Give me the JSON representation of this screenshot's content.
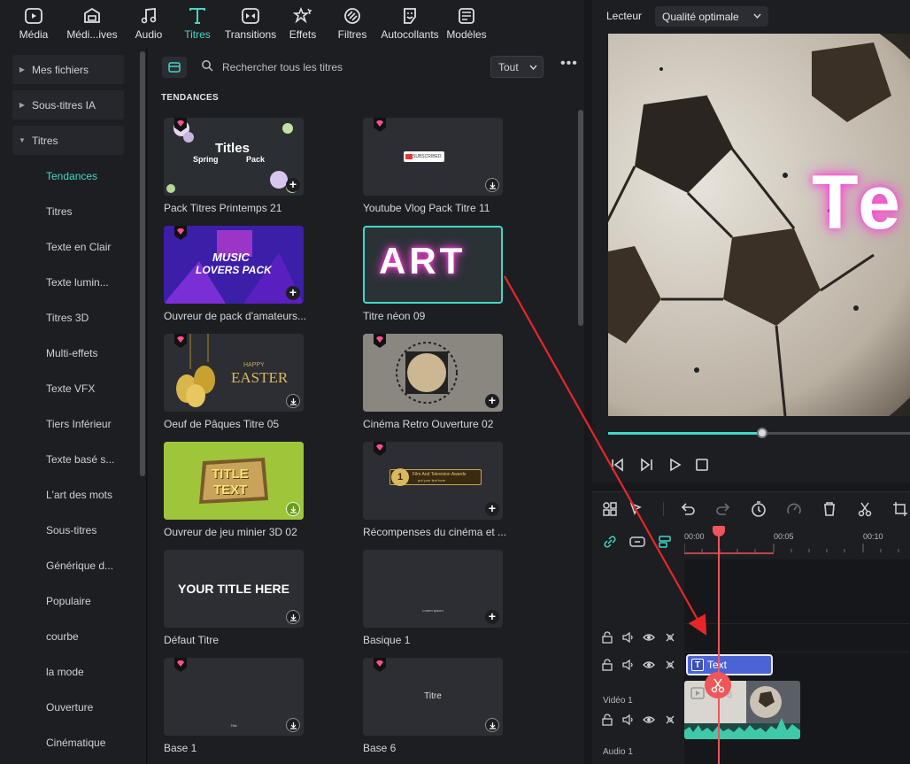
{
  "toolbar": {
    "items": [
      {
        "label": "Média",
        "icon": "media-icon"
      },
      {
        "label": "Médi...ives",
        "icon": "stock-media-icon"
      },
      {
        "label": "Audio",
        "icon": "music-note-icon"
      },
      {
        "label": "Titres",
        "icon": "title-t-icon",
        "active": true
      },
      {
        "label": "Transitions",
        "icon": "transitions-icon"
      },
      {
        "label": "Effets",
        "icon": "effects-icon"
      },
      {
        "label": "Filtres",
        "icon": "filters-icon"
      },
      {
        "label": "Autocollants",
        "icon": "stickers-icon"
      },
      {
        "label": "Modèles",
        "icon": "templates-icon"
      }
    ]
  },
  "sidebar": {
    "sections": [
      "Mes fichiers",
      "Sous-titres IA",
      "Titres"
    ],
    "items": [
      "Tendances",
      "Titres",
      "Texte en Clair",
      "Texte lumin...",
      "Titres 3D",
      "Multi-effets",
      "Texte VFX",
      "Tiers Inférieur",
      "Texte basé s...",
      "L'art des mots",
      "Sous-titres",
      "Générique d...",
      "Populaire",
      "courbe",
      "la mode",
      "Ouverture",
      "Cinématique"
    ]
  },
  "grid": {
    "search_placeholder": "Rechercher tous les titres",
    "filter_value": "Tout",
    "more": "•••",
    "section": "TENDANCES",
    "cards": [
      {
        "name": "Pack Titres Printemps 21",
        "thumb_title": "Titles",
        "thumb_sub1": "Spring",
        "thumb_sub2": "Pack"
      },
      {
        "name": "Youtube Vlog Pack Titre 11",
        "thumb_title": "SUBSCRIBED"
      },
      {
        "name": "Ouvreur de pack d'amateurs...",
        "thumb_title": "MUSIC",
        "thumb_sub1": "LOVERS PACK"
      },
      {
        "name": "Titre néon 09",
        "thumb_title": "ART"
      },
      {
        "name": "Oeuf de Pâques Titre 05",
        "thumb_title": "EASTER",
        "thumb_sub1": "HAPPY"
      },
      {
        "name": "Cinéma Retro Ouverture 02"
      },
      {
        "name": "Ouvreur de jeu minier 3D 02",
        "thumb_title": "TITLE",
        "thumb_sub1": "TEXT"
      },
      {
        "name": "Récompenses du cinéma et ...",
        "thumb_title": "Film And Television Awards",
        "thumb_sub1": "put your text here"
      },
      {
        "name": "Défaut Titre",
        "thumb_title": "YOUR TITLE HERE"
      },
      {
        "name": "Basique 1",
        "thumb_title": "Lorem Ipsum"
      },
      {
        "name": "Base 1",
        "thumb_title": "Title"
      },
      {
        "name": "Base 6",
        "thumb_title": "Titre"
      }
    ]
  },
  "player": {
    "label": "Lecteur",
    "quality": "Qualité optimale",
    "overlay_text": "Te",
    "progress": 0.51
  },
  "timeline": {
    "ruler": [
      "00:00",
      "00:05",
      "00:10"
    ],
    "tracks": {
      "video": "Vidéo 1",
      "audio": "Audio 1"
    },
    "text_clip": "Text",
    "video_clip_label": "8"
  },
  "colors": {
    "accent": "#40d9c6",
    "playhead": "#f0555a",
    "text_clip": "#4c63d6",
    "premium": "#ff4f8a"
  }
}
